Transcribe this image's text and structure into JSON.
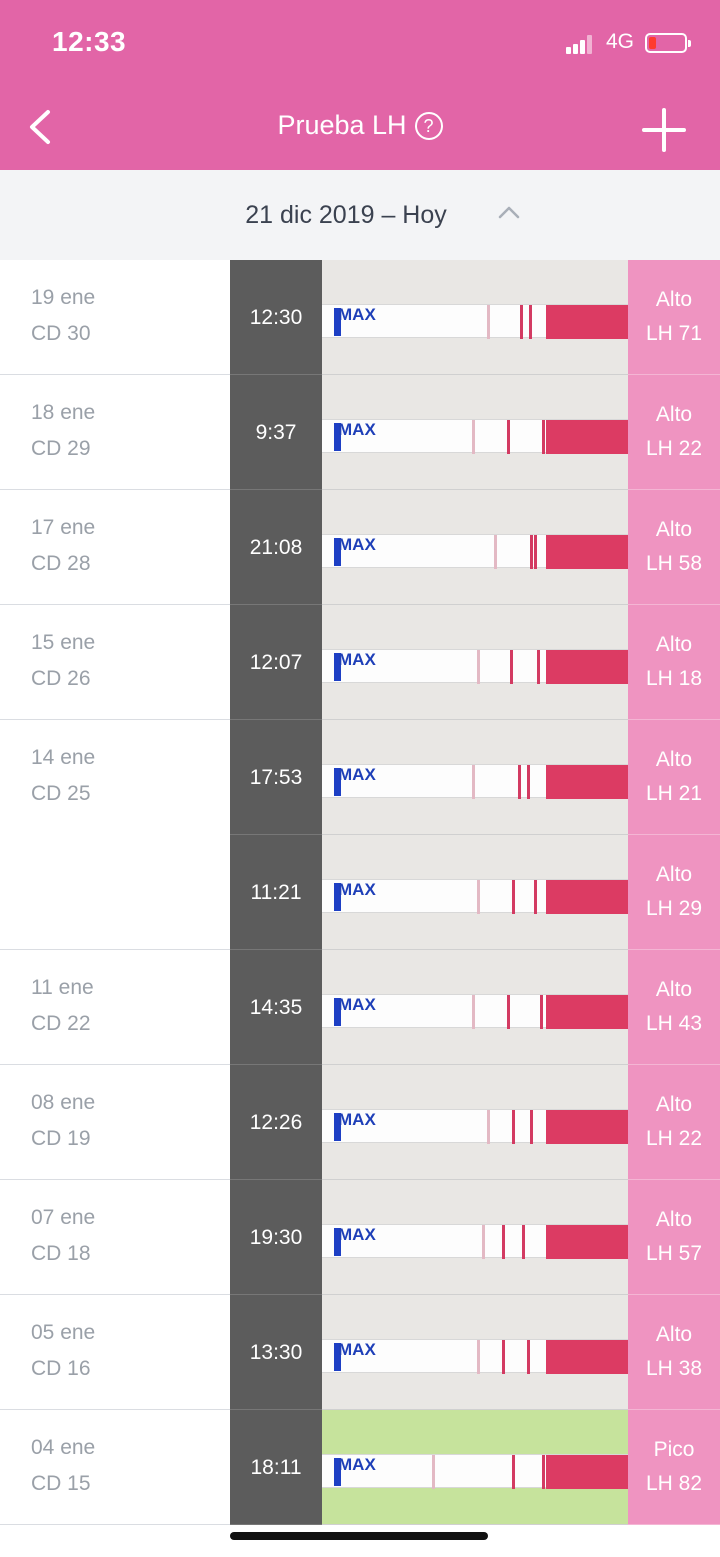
{
  "status_bar": {
    "time": "12:33",
    "network": "4G",
    "battery_color": "#ff3b30"
  },
  "nav": {
    "title": "Prueba LH",
    "help": "?"
  },
  "date_range": {
    "label": "21 dic 2019 – Hoy"
  },
  "colors": {
    "header": "#e265a7",
    "result_cell": "#ef94c1",
    "test_line": "#d33b62"
  },
  "entries": [
    {
      "date": "19 ene",
      "cycle_day": "CD 30",
      "time": "12:30",
      "status": "Alto",
      "lh": "LH 71"
    },
    {
      "date": "18 ene",
      "cycle_day": "CD 29",
      "time": "9:37",
      "status": "Alto",
      "lh": "LH 22"
    },
    {
      "date": "17 ene",
      "cycle_day": "CD 28",
      "time": "21:08",
      "status": "Alto",
      "lh": "LH 58"
    },
    {
      "date": "15 ene",
      "cycle_day": "CD 26",
      "time": "12:07",
      "status": "Alto",
      "lh": "LH 18"
    },
    {
      "date": "14 ene",
      "cycle_day": "CD 25",
      "time": "17:53",
      "status": "Alto",
      "lh": "LH 21"
    },
    {
      "date": "",
      "cycle_day": "",
      "time": "11:21",
      "status": "Alto",
      "lh": "LH 29"
    },
    {
      "date": "11 ene",
      "cycle_day": "CD 22",
      "time": "14:35",
      "status": "Alto",
      "lh": "LH 43"
    },
    {
      "date": "08 ene",
      "cycle_day": "CD 19",
      "time": "12:26",
      "status": "Alto",
      "lh": "LH 22"
    },
    {
      "date": "07 ene",
      "cycle_day": "CD 18",
      "time": "19:30",
      "status": "Alto",
      "lh": "LH 57"
    },
    {
      "date": "05 ene",
      "cycle_day": "CD 16",
      "time": "13:30",
      "status": "Alto",
      "lh": "LH 38"
    },
    {
      "date": "04 ene",
      "cycle_day": "CD 15",
      "time": "18:11",
      "status": "Pico",
      "lh": "LH 82"
    }
  ],
  "strip_label": "MAX"
}
